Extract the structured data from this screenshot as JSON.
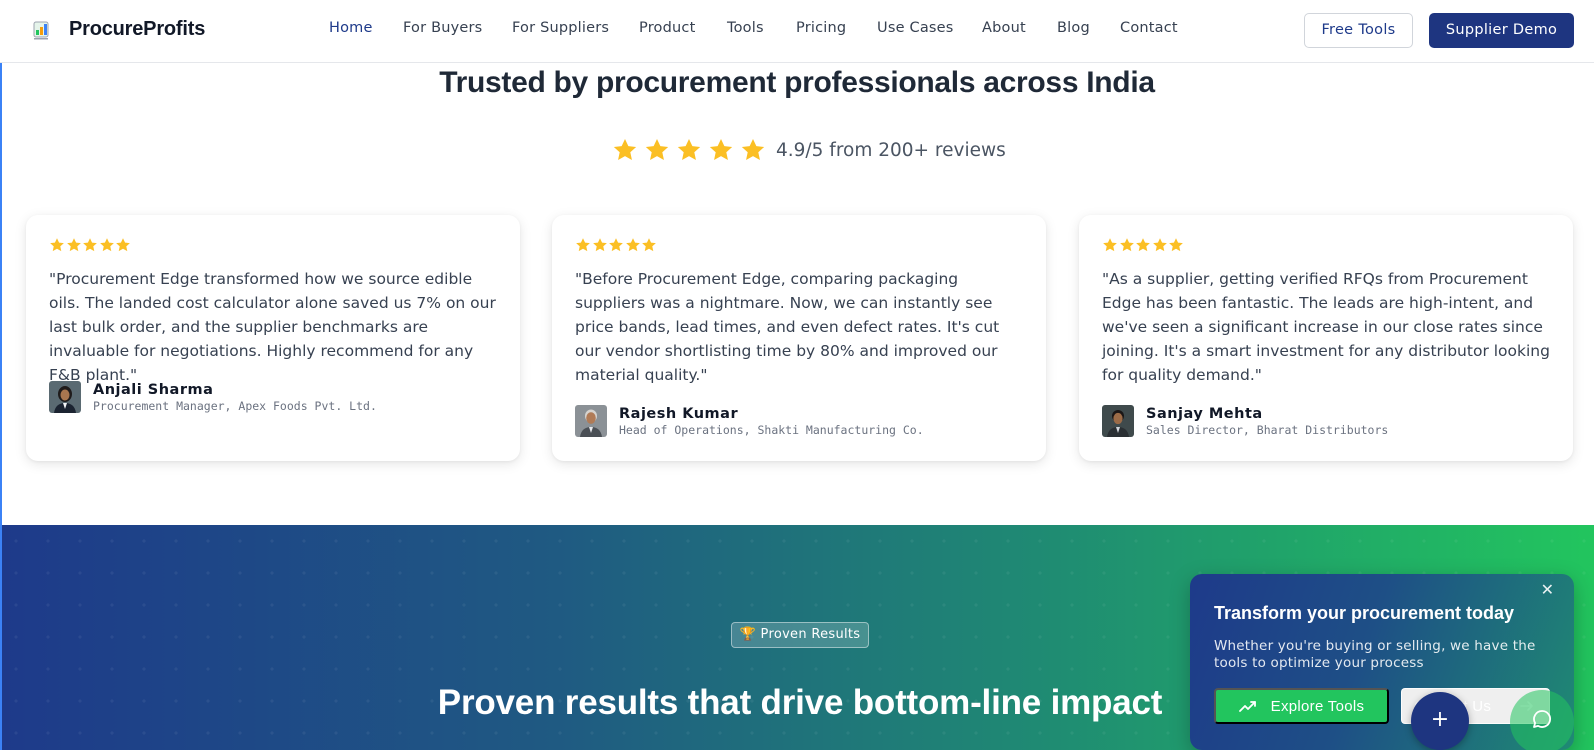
{
  "brand": {
    "name": "ProcureProfits"
  },
  "nav": {
    "links": [
      {
        "label": "Home",
        "active": true
      },
      {
        "label": "For Buyers"
      },
      {
        "label": "For Suppliers"
      },
      {
        "label": "Product"
      },
      {
        "label": "Tools"
      },
      {
        "label": "Pricing"
      },
      {
        "label": "Use Cases"
      },
      {
        "label": "About"
      },
      {
        "label": "Blog"
      },
      {
        "label": "Contact"
      }
    ],
    "free_tools_label": "Free Tools",
    "supplier_demo_label": "Supplier Demo"
  },
  "testimonials": {
    "title": "Trusted by procurement professionals across India",
    "rating_text": "4.9/5 from 200+ reviews",
    "star_color": "#fbbf24",
    "cards": [
      {
        "quote": "\"Procurement Edge transformed how we source edible oils. The landed cost calculator alone saved us 7% on our last bulk order, and the supplier benchmarks are invaluable for negotiations. Highly recommend for any F&B plant.\"",
        "name": "Anjali Sharma",
        "role": "Procurement Manager, Apex Foods Pvt. Ltd.",
        "rating": 5
      },
      {
        "quote": "\"Before Procurement Edge, comparing packaging suppliers was a nightmare. Now, we can instantly see price bands, lead times, and even defect rates. It's cut our vendor shortlisting time by 80% and improved our material quality.\"",
        "name": "Rajesh Kumar",
        "role": "Head of Operations, Shakti Manufacturing Co.",
        "rating": 5
      },
      {
        "quote": "\"As a supplier, getting verified RFQs from Procurement Edge has been fantastic. The leads are high-intent, and we've seen a significant increase in our close rates since joining. It's a smart investment for any distributor looking for quality demand.\"",
        "name": "Sanjay Mehta",
        "role": "Sales Director, Bharat Distributors",
        "rating": 5
      }
    ]
  },
  "results": {
    "badge": "🏆 Proven Results",
    "title": "Proven results that drive bottom-line impact"
  },
  "popup": {
    "close": "✕",
    "title": "Transform your procurement today",
    "description": "Whether you're buying or selling, we have the tools to optimize your process",
    "explore_label": "Explore Tools",
    "contact_label": "Contact Us",
    "fab_label": "+"
  }
}
